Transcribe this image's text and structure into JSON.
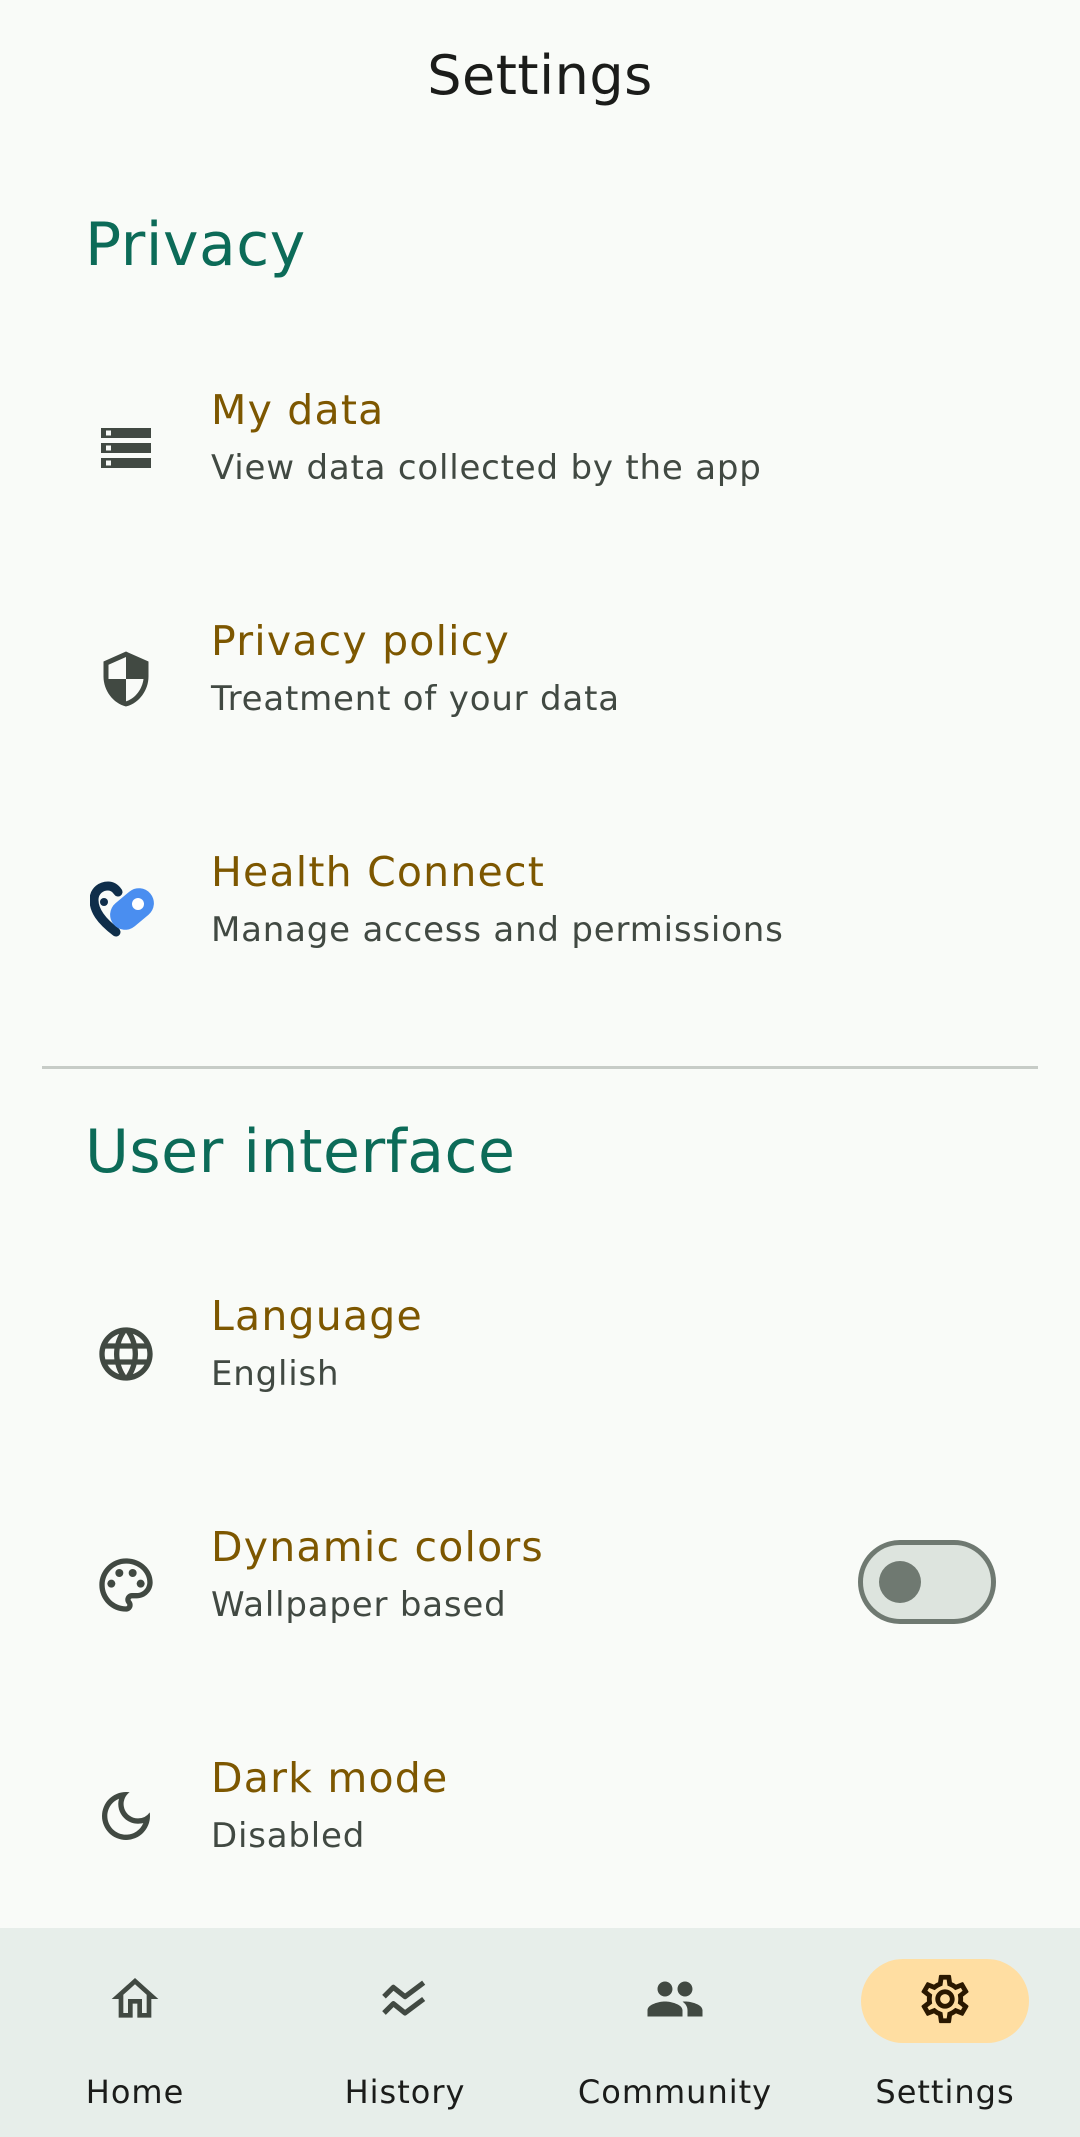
{
  "header": {
    "title": "Settings"
  },
  "privacy": {
    "title": "Privacy",
    "items": [
      {
        "icon": "storage-icon",
        "title": "My data",
        "subtitle": "View data collected by the app"
      },
      {
        "icon": "shield-icon",
        "title": "Privacy policy",
        "subtitle": "Treatment of your data"
      },
      {
        "icon": "health-connect-icon",
        "title": "Health Connect",
        "subtitle": "Manage access and permissions"
      }
    ]
  },
  "ui": {
    "title": "User interface",
    "items": [
      {
        "icon": "globe-icon",
        "title": "Language",
        "subtitle": "English"
      },
      {
        "icon": "palette-icon",
        "title": "Dynamic colors",
        "subtitle": "Wallpaper based",
        "toggle_on": false
      },
      {
        "icon": "moon-icon",
        "title": "Dark mode",
        "subtitle": "Disabled"
      }
    ]
  },
  "nav": {
    "items": [
      {
        "icon": "home-icon",
        "label": "Home",
        "active": false
      },
      {
        "icon": "history-icon",
        "label": "History",
        "active": false
      },
      {
        "icon": "community-icon",
        "label": "Community",
        "active": false
      },
      {
        "icon": "settings-icon",
        "label": "Settings",
        "active": true
      }
    ]
  },
  "colors": {
    "background": "#f9fbf8",
    "section_title": "#0c6b58",
    "item_title": "#7d5700",
    "nav_background": "#e7eeea",
    "nav_active_pill": "#ffdea2"
  }
}
